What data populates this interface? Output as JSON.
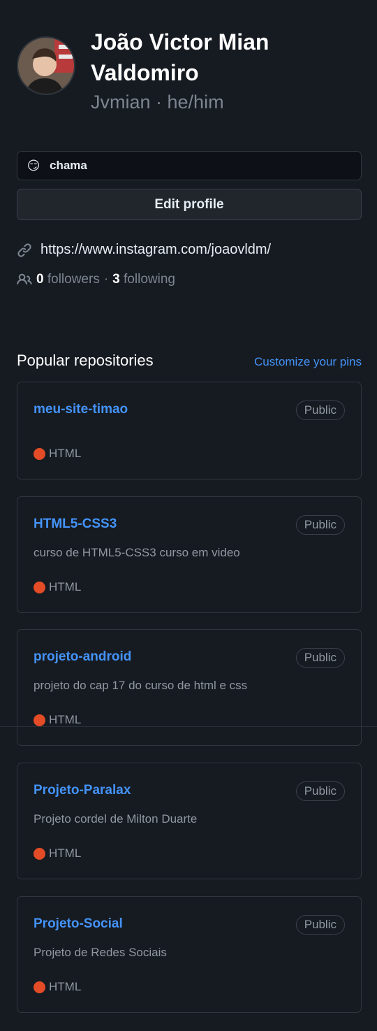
{
  "profile": {
    "name_line1": "João Victor Mian",
    "name_line2": "Valdomiro",
    "subtitle": "Jvmian · he/him",
    "status_emoji": "😏",
    "status_text": "chama",
    "edit_label": "Edit profile",
    "website": "https://www.instagram.com/joaovldm/",
    "followers_count": "0",
    "followers_label": "followers",
    "separator": "·",
    "following_count": "3",
    "following_label": "following"
  },
  "popular": {
    "title": "Popular repositories",
    "customize_label": "Customize your pins",
    "repos": [
      {
        "name": "meu-site-timao",
        "visibility": "Public",
        "description": "",
        "language": "HTML"
      },
      {
        "name": "HTML5-CSS3",
        "visibility": "Public",
        "description": "curso de HTML5-CSS3 curso em video",
        "language": "HTML"
      },
      {
        "name": "projeto-android",
        "visibility": "Public",
        "description": "projeto do cap 17 do curso de html e css",
        "language": "HTML"
      },
      {
        "name": "Projeto-Paralax",
        "visibility": "Public",
        "description": "Projeto cordel de Milton Duarte",
        "language": "HTML"
      },
      {
        "name": "Projeto-Social",
        "visibility": "Public",
        "description": "Projeto de Redes Sociais",
        "language": "HTML"
      }
    ]
  },
  "colors": {
    "background": "#161b22",
    "link": "#4493f8",
    "html_lang": "#e34c26",
    "border": "#30363d"
  },
  "icons": [
    "link-icon",
    "people-icon"
  ]
}
